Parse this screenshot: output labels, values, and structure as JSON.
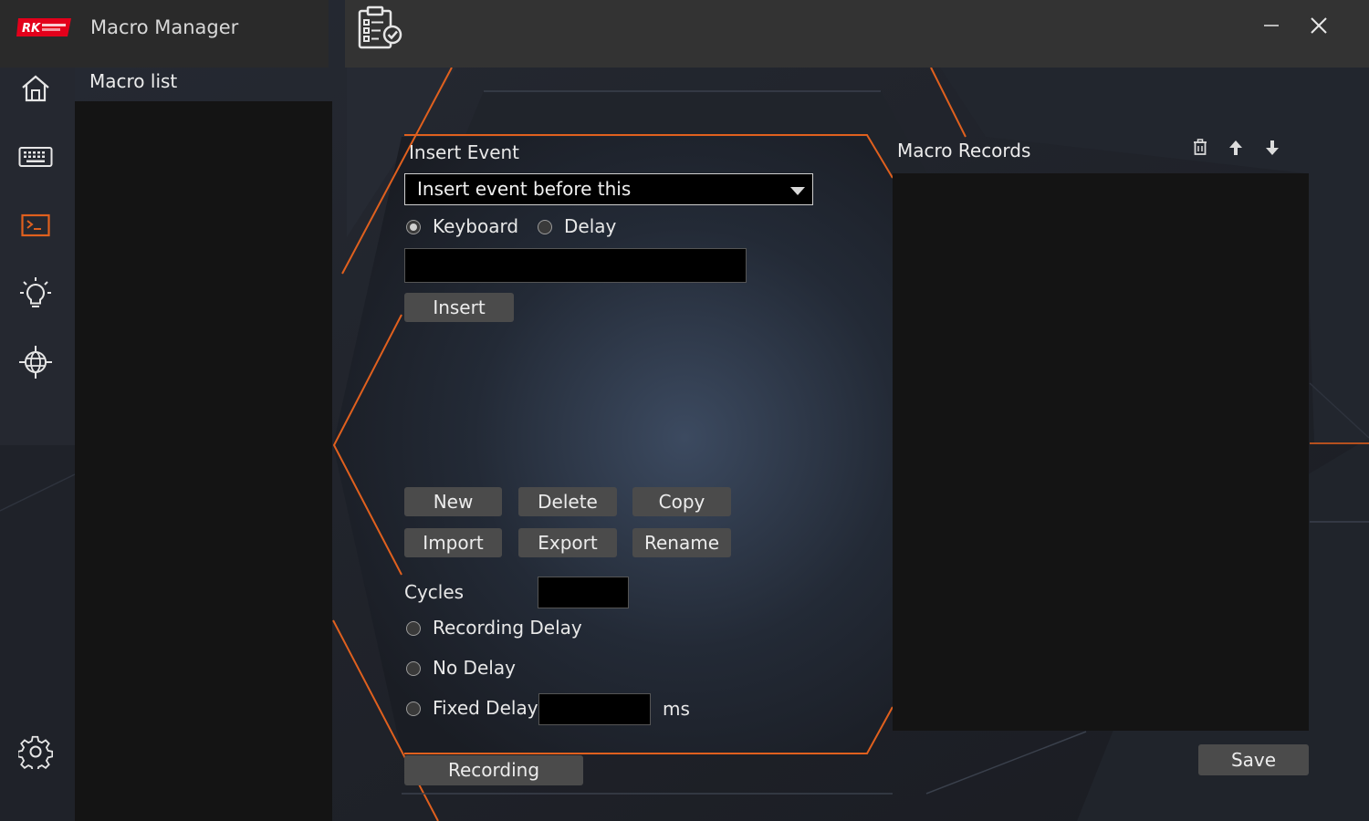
{
  "app": {
    "title": "Macro Manager"
  },
  "macro_list": {
    "title": "Macro list",
    "items": []
  },
  "nav": {
    "items": [
      "home-icon",
      "keyboard-icon",
      "macro-icon",
      "lighting-icon",
      "network-icon"
    ],
    "active": "macro-icon",
    "settings": "gear-icon"
  },
  "insert_event": {
    "title": "Insert Event",
    "select_value": "Insert event before this",
    "radio_keyboard": "Keyboard",
    "radio_delay": "Delay",
    "selected": "Keyboard",
    "input_value": "",
    "insert_button": "Insert"
  },
  "actions": {
    "new": "New",
    "delete": "Delete",
    "copy": "Copy",
    "import": "Import",
    "export": "Export",
    "rename": "Rename"
  },
  "cycles": {
    "label": "Cycles",
    "value": ""
  },
  "delay_options": {
    "recording_delay": "Recording Delay",
    "no_delay": "No Delay",
    "fixed_delay": "Fixed Delay",
    "fixed_delay_value": "",
    "unit": "ms"
  },
  "recording_button": "Recording",
  "records": {
    "title": "Macro Records",
    "items": []
  },
  "save_button": "Save",
  "colors": {
    "accent": "#e0601e",
    "button": "#4b4b4b",
    "panel": "#141414",
    "logo_red": "#e3001b"
  }
}
